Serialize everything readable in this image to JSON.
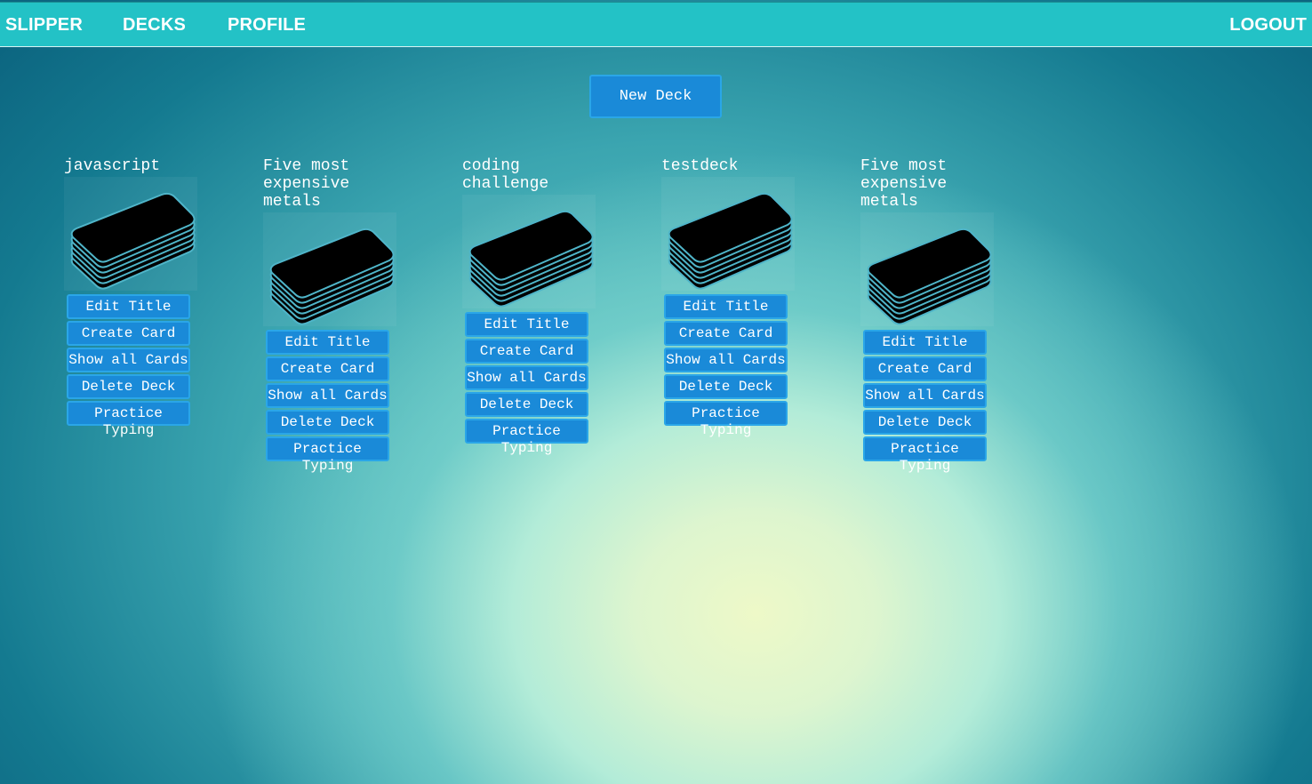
{
  "nav": {
    "brand": "SLIPPER",
    "decks": "DECKS",
    "profile": "PROFILE",
    "logout": "LOGOUT"
  },
  "new_deck_label": "New Deck",
  "deck_icon": "card-stack-icon",
  "colors": {
    "topbar": "#23c2c6",
    "button": "#1a8ad8",
    "button_border": "#2aa6e8",
    "card": "#000000",
    "card_edge": "#4fb5c9"
  },
  "decks": [
    {
      "title": "javascript",
      "buttons": [
        "Edit Title",
        "Create Card",
        "Show all Cards",
        "Delete Deck",
        "Practice Typing"
      ]
    },
    {
      "title": "Five most expensive metals",
      "buttons": [
        "Edit Title",
        "Create Card",
        "Show all Cards",
        "Delete Deck",
        "Practice Typing"
      ]
    },
    {
      "title": "coding challenge",
      "buttons": [
        "Edit Title",
        "Create Card",
        "Show all Cards",
        "Delete Deck",
        "Practice Typing"
      ]
    },
    {
      "title": "testdeck",
      "buttons": [
        "Edit Title",
        "Create Card",
        "Show all Cards",
        "Delete Deck",
        "Practice Typing"
      ]
    },
    {
      "title": "Five most expensive metals",
      "buttons": [
        "Edit Title",
        "Create Card",
        "Show all Cards",
        "Delete Deck",
        "Practice Typing"
      ]
    }
  ]
}
